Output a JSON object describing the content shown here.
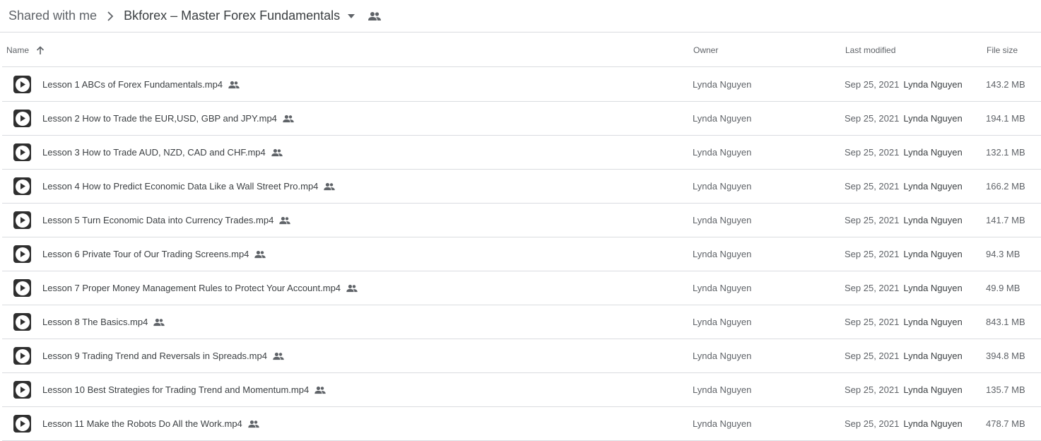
{
  "breadcrumb": {
    "root": "Shared with me",
    "current": "Bkforex – Master Forex Fundamentals"
  },
  "columns": {
    "name": "Name",
    "owner": "Owner",
    "last_modified": "Last modified",
    "file_size": "File size"
  },
  "icons": {
    "separator": "chevron-right-icon",
    "dropdown": "arrow-drop-down-icon",
    "shared": "people-icon",
    "sort": "arrow-up-icon",
    "file": "video-play-icon"
  },
  "colors": {
    "text_primary": "#3c4043",
    "text_secondary": "#5f6368",
    "divider": "#dadce0"
  },
  "files": [
    {
      "name": "Lesson 1 ABCs of Forex Fundamentals.mp4",
      "owner": "Lynda Nguyen",
      "modified_date": "Sep 25, 2021",
      "modified_by": "Lynda Nguyen",
      "size": "143.2 MB"
    },
    {
      "name": "Lesson 2 How to Trade the EUR,USD, GBP and JPY.mp4",
      "owner": "Lynda Nguyen",
      "modified_date": "Sep 25, 2021",
      "modified_by": "Lynda Nguyen",
      "size": "194.1 MB"
    },
    {
      "name": "Lesson 3 How to Trade AUD, NZD, CAD and CHF.mp4",
      "owner": "Lynda Nguyen",
      "modified_date": "Sep 25, 2021",
      "modified_by": "Lynda Nguyen",
      "size": "132.1 MB"
    },
    {
      "name": "Lesson 4 How to Predict Economic Data Like a Wall Street Pro.mp4",
      "owner": "Lynda Nguyen",
      "modified_date": "Sep 25, 2021",
      "modified_by": "Lynda Nguyen",
      "size": "166.2 MB"
    },
    {
      "name": "Lesson 5 Turn Economic Data into Currency Trades.mp4",
      "owner": "Lynda Nguyen",
      "modified_date": "Sep 25, 2021",
      "modified_by": "Lynda Nguyen",
      "size": "141.7 MB"
    },
    {
      "name": "Lesson 6 Private Tour of Our Trading Screens.mp4",
      "owner": "Lynda Nguyen",
      "modified_date": "Sep 25, 2021",
      "modified_by": "Lynda Nguyen",
      "size": "94.3 MB"
    },
    {
      "name": "Lesson 7 Proper Money Management Rules to Protect Your Account.mp4",
      "owner": "Lynda Nguyen",
      "modified_date": "Sep 25, 2021",
      "modified_by": "Lynda Nguyen",
      "size": "49.9 MB"
    },
    {
      "name": "Lesson 8 The Basics.mp4",
      "owner": "Lynda Nguyen",
      "modified_date": "Sep 25, 2021",
      "modified_by": "Lynda Nguyen",
      "size": "843.1 MB"
    },
    {
      "name": "Lesson 9 Trading Trend and Reversals in Spreads.mp4",
      "owner": "Lynda Nguyen",
      "modified_date": "Sep 25, 2021",
      "modified_by": "Lynda Nguyen",
      "size": "394.8 MB"
    },
    {
      "name": "Lesson 10 Best Strategies for Trading Trend and Momentum.mp4",
      "owner": "Lynda Nguyen",
      "modified_date": "Sep 25, 2021",
      "modified_by": "Lynda Nguyen",
      "size": "135.7 MB"
    },
    {
      "name": "Lesson 11 Make the Robots Do All the Work.mp4",
      "owner": "Lynda Nguyen",
      "modified_date": "Sep 25, 2021",
      "modified_by": "Lynda Nguyen",
      "size": "478.7 MB"
    }
  ]
}
